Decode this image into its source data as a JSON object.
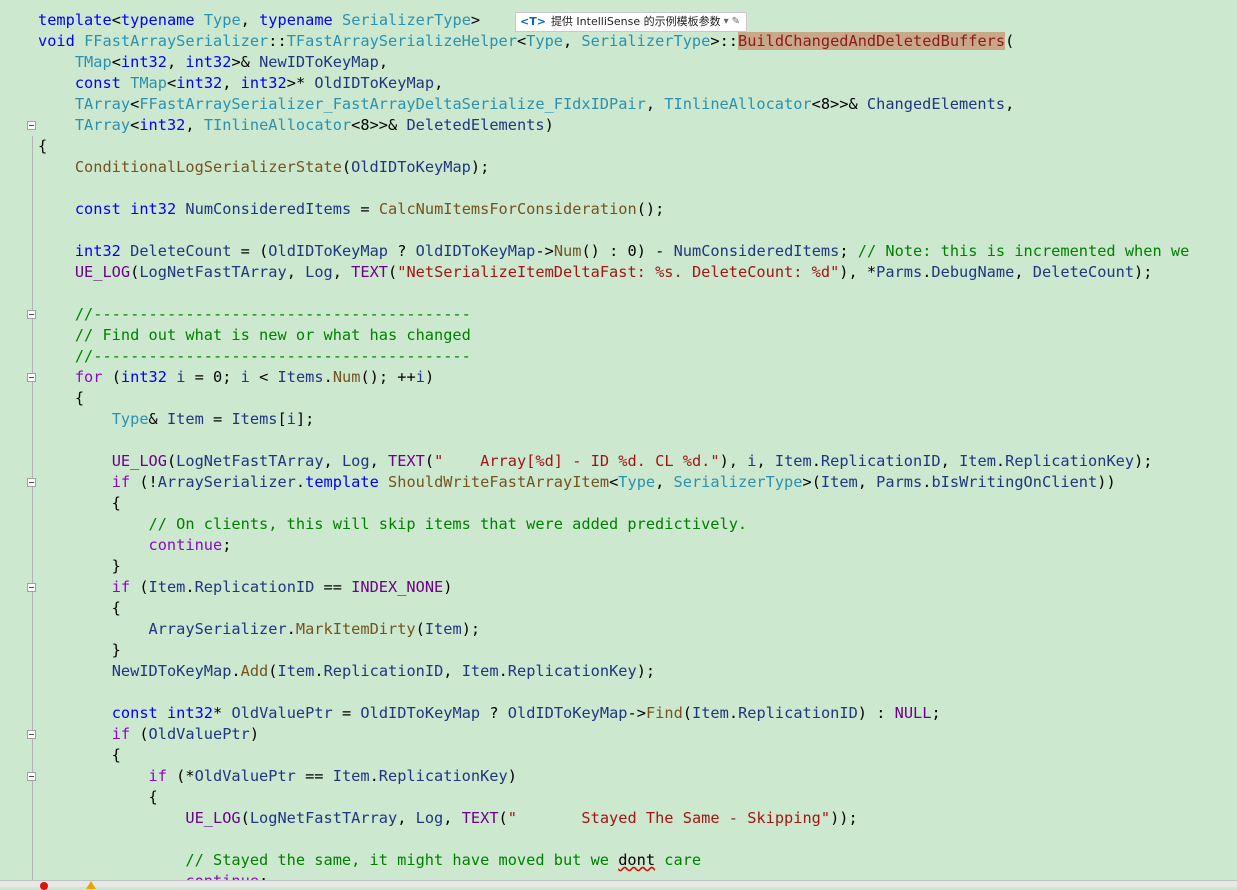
{
  "intellisense": {
    "badge": "<T>",
    "text": "提供 IntelliSense 的示例模板参数",
    "chevron": "▾",
    "edit_icon": "✎"
  },
  "colors": {
    "background": "#cce8cf",
    "keyword": "#0000ff",
    "type": "#2b91af",
    "function": "#74531f",
    "macro": "#6f008a",
    "string": "#a31515",
    "comment": "#008000",
    "highlight": "#c9a888"
  },
  "code_lines": [
    [
      [
        "kw",
        "template"
      ],
      [
        "pl",
        "<"
      ],
      [
        "kw",
        "typename"
      ],
      [
        "pl",
        " "
      ],
      [
        "ty",
        "Type"
      ],
      [
        "pl",
        ", "
      ],
      [
        "kw",
        "typename"
      ],
      [
        "pl",
        " "
      ],
      [
        "ty",
        "SerializerType"
      ],
      [
        "pl",
        ">"
      ]
    ],
    [
      [
        "kw",
        "void"
      ],
      [
        "pl",
        " "
      ],
      [
        "ty",
        "FFastArraySerializer"
      ],
      [
        "pl",
        "::"
      ],
      [
        "ty",
        "TFastArraySerializeHelper"
      ],
      [
        "pl",
        "<"
      ],
      [
        "ty",
        "Type"
      ],
      [
        "pl",
        ", "
      ],
      [
        "ty",
        "SerializerType"
      ],
      [
        "pl",
        ">::"
      ],
      [
        "hl",
        "BuildChangedAndDeletedBuffers"
      ],
      [
        "pl",
        "("
      ]
    ],
    [
      [
        "pl",
        "    "
      ],
      [
        "ty",
        "TMap"
      ],
      [
        "pl",
        "<"
      ],
      [
        "kw",
        "int32"
      ],
      [
        "pl",
        ", "
      ],
      [
        "kw",
        "int32"
      ],
      [
        "pl",
        ">& "
      ],
      [
        "var",
        "NewIDToKeyMap"
      ],
      [
        "pl",
        ","
      ]
    ],
    [
      [
        "pl",
        "    "
      ],
      [
        "kw",
        "const"
      ],
      [
        "pl",
        " "
      ],
      [
        "ty",
        "TMap"
      ],
      [
        "pl",
        "<"
      ],
      [
        "kw",
        "int32"
      ],
      [
        "pl",
        ", "
      ],
      [
        "kw",
        "int32"
      ],
      [
        "pl",
        ">* "
      ],
      [
        "var",
        "OldIDToKeyMap"
      ],
      [
        "pl",
        ","
      ]
    ],
    [
      [
        "pl",
        "    "
      ],
      [
        "ty",
        "TArray"
      ],
      [
        "pl",
        "<"
      ],
      [
        "ty",
        "FFastArraySerializer_FastArrayDeltaSerialize_FIdxIDPair"
      ],
      [
        "pl",
        ", "
      ],
      [
        "ty",
        "TInlineAllocator"
      ],
      [
        "pl",
        "<8>>& "
      ],
      [
        "var",
        "ChangedElements"
      ],
      [
        "pl",
        ","
      ]
    ],
    [
      [
        "pl",
        "    "
      ],
      [
        "ty",
        "TArray"
      ],
      [
        "pl",
        "<"
      ],
      [
        "kw",
        "int32"
      ],
      [
        "pl",
        ", "
      ],
      [
        "ty",
        "TInlineAllocator"
      ],
      [
        "pl",
        "<8>>& "
      ],
      [
        "var",
        "DeletedElements"
      ],
      [
        "pl",
        ")"
      ]
    ],
    [
      [
        "pl",
        "{"
      ]
    ],
    [
      [
        "pl",
        "    "
      ],
      [
        "fn",
        "ConditionalLogSerializerState"
      ],
      [
        "pl",
        "("
      ],
      [
        "var",
        "OldIDToKeyMap"
      ],
      [
        "pl",
        ");"
      ]
    ],
    [
      [
        "pl",
        ""
      ]
    ],
    [
      [
        "pl",
        "    "
      ],
      [
        "kw",
        "const"
      ],
      [
        "pl",
        " "
      ],
      [
        "kw",
        "int32"
      ],
      [
        "pl",
        " "
      ],
      [
        "var",
        "NumConsideredItems"
      ],
      [
        "pl",
        " = "
      ],
      [
        "fn",
        "CalcNumItemsForConsideration"
      ],
      [
        "pl",
        "();"
      ]
    ],
    [
      [
        "pl",
        ""
      ]
    ],
    [
      [
        "pl",
        "    "
      ],
      [
        "kw",
        "int32"
      ],
      [
        "pl",
        " "
      ],
      [
        "var",
        "DeleteCount"
      ],
      [
        "pl",
        " = ("
      ],
      [
        "var",
        "OldIDToKeyMap"
      ],
      [
        "pl",
        " ? "
      ],
      [
        "var",
        "OldIDToKeyMap"
      ],
      [
        "pl",
        "->"
      ],
      [
        "fn",
        "Num"
      ],
      [
        "pl",
        "() : 0) - "
      ],
      [
        "var",
        "NumConsideredItems"
      ],
      [
        "pl",
        "; "
      ],
      [
        "com",
        "// Note: this is incremented when we"
      ]
    ],
    [
      [
        "pl",
        "    "
      ],
      [
        "mac",
        "UE_LOG"
      ],
      [
        "pl",
        "("
      ],
      [
        "var",
        "LogNetFastTArray"
      ],
      [
        "pl",
        ", "
      ],
      [
        "var",
        "Log"
      ],
      [
        "pl",
        ", "
      ],
      [
        "mac",
        "TEXT"
      ],
      [
        "pl",
        "("
      ],
      [
        "str",
        "\"NetSerializeItemDeltaFast: %s. DeleteCount: %d\""
      ],
      [
        "pl",
        "), *"
      ],
      [
        "var",
        "Parms"
      ],
      [
        "pl",
        "."
      ],
      [
        "mem",
        "DebugName"
      ],
      [
        "pl",
        ", "
      ],
      [
        "var",
        "DeleteCount"
      ],
      [
        "pl",
        ");"
      ]
    ],
    [
      [
        "pl",
        ""
      ]
    ],
    [
      [
        "pl",
        "    "
      ],
      [
        "com",
        "//-----------------------------------------"
      ]
    ],
    [
      [
        "pl",
        "    "
      ],
      [
        "com",
        "// Find out what is new or what has changed"
      ]
    ],
    [
      [
        "pl",
        "    "
      ],
      [
        "com",
        "//-----------------------------------------"
      ]
    ],
    [
      [
        "pl",
        "    "
      ],
      [
        "ctl",
        "for"
      ],
      [
        "pl",
        " ("
      ],
      [
        "kw",
        "int32"
      ],
      [
        "pl",
        " "
      ],
      [
        "var",
        "i"
      ],
      [
        "pl",
        " = 0; "
      ],
      [
        "var",
        "i"
      ],
      [
        "pl",
        " < "
      ],
      [
        "mem",
        "Items"
      ],
      [
        "pl",
        "."
      ],
      [
        "fn",
        "Num"
      ],
      [
        "pl",
        "(); ++"
      ],
      [
        "var",
        "i"
      ],
      [
        "pl",
        ")"
      ]
    ],
    [
      [
        "pl",
        "    {"
      ]
    ],
    [
      [
        "pl",
        "        "
      ],
      [
        "ty",
        "Type"
      ],
      [
        "pl",
        "& "
      ],
      [
        "var",
        "Item"
      ],
      [
        "pl",
        " = "
      ],
      [
        "mem",
        "Items"
      ],
      [
        "pl",
        "["
      ],
      [
        "var",
        "i"
      ],
      [
        "pl",
        "];"
      ]
    ],
    [
      [
        "pl",
        ""
      ]
    ],
    [
      [
        "pl",
        "        "
      ],
      [
        "mac",
        "UE_LOG"
      ],
      [
        "pl",
        "("
      ],
      [
        "var",
        "LogNetFastTArray"
      ],
      [
        "pl",
        ", "
      ],
      [
        "var",
        "Log"
      ],
      [
        "pl",
        ", "
      ],
      [
        "mac",
        "TEXT"
      ],
      [
        "pl",
        "("
      ],
      [
        "str",
        "\"    Array[%d] - ID %d. CL %d.\""
      ],
      [
        "pl",
        "), "
      ],
      [
        "var",
        "i"
      ],
      [
        "pl",
        ", "
      ],
      [
        "var",
        "Item"
      ],
      [
        "pl",
        "."
      ],
      [
        "mem",
        "ReplicationID"
      ],
      [
        "pl",
        ", "
      ],
      [
        "var",
        "Item"
      ],
      [
        "pl",
        "."
      ],
      [
        "mem",
        "ReplicationKey"
      ],
      [
        "pl",
        ");"
      ]
    ],
    [
      [
        "pl",
        "        "
      ],
      [
        "ctl",
        "if"
      ],
      [
        "pl",
        " (!"
      ],
      [
        "var",
        "ArraySerializer"
      ],
      [
        "pl",
        "."
      ],
      [
        "kw",
        "template"
      ],
      [
        "pl",
        " "
      ],
      [
        "fn",
        "ShouldWriteFastArrayItem"
      ],
      [
        "pl",
        "<"
      ],
      [
        "ty",
        "Type"
      ],
      [
        "pl",
        ", "
      ],
      [
        "ty",
        "SerializerType"
      ],
      [
        "pl",
        ">("
      ],
      [
        "var",
        "Item"
      ],
      [
        "pl",
        ", "
      ],
      [
        "var",
        "Parms"
      ],
      [
        "pl",
        "."
      ],
      [
        "mem",
        "bIsWritingOnClient"
      ],
      [
        "pl",
        "))"
      ]
    ],
    [
      [
        "pl",
        "        {"
      ]
    ],
    [
      [
        "pl",
        "            "
      ],
      [
        "com",
        "// On clients, this will skip items that were added predictively."
      ]
    ],
    [
      [
        "pl",
        "            "
      ],
      [
        "ctl",
        "continue"
      ],
      [
        "pl",
        ";"
      ]
    ],
    [
      [
        "pl",
        "        }"
      ]
    ],
    [
      [
        "pl",
        "        "
      ],
      [
        "ctl",
        "if"
      ],
      [
        "pl",
        " ("
      ],
      [
        "var",
        "Item"
      ],
      [
        "pl",
        "."
      ],
      [
        "mem",
        "ReplicationID"
      ],
      [
        "pl",
        " == "
      ],
      [
        "mac",
        "INDEX_NONE"
      ],
      [
        "pl",
        ")"
      ]
    ],
    [
      [
        "pl",
        "        {"
      ]
    ],
    [
      [
        "pl",
        "            "
      ],
      [
        "var",
        "ArraySerializer"
      ],
      [
        "pl",
        "."
      ],
      [
        "fn",
        "MarkItemDirty"
      ],
      [
        "pl",
        "("
      ],
      [
        "var",
        "Item"
      ],
      [
        "pl",
        ");"
      ]
    ],
    [
      [
        "pl",
        "        }"
      ]
    ],
    [
      [
        "pl",
        "        "
      ],
      [
        "var",
        "NewIDToKeyMap"
      ],
      [
        "pl",
        "."
      ],
      [
        "fn",
        "Add"
      ],
      [
        "pl",
        "("
      ],
      [
        "var",
        "Item"
      ],
      [
        "pl",
        "."
      ],
      [
        "mem",
        "ReplicationID"
      ],
      [
        "pl",
        ", "
      ],
      [
        "var",
        "Item"
      ],
      [
        "pl",
        "."
      ],
      [
        "mem",
        "ReplicationKey"
      ],
      [
        "pl",
        ");"
      ]
    ],
    [
      [
        "pl",
        ""
      ]
    ],
    [
      [
        "pl",
        "        "
      ],
      [
        "kw",
        "const"
      ],
      [
        "pl",
        " "
      ],
      [
        "kw",
        "int32"
      ],
      [
        "pl",
        "* "
      ],
      [
        "var",
        "OldValuePtr"
      ],
      [
        "pl",
        " = "
      ],
      [
        "var",
        "OldIDToKeyMap"
      ],
      [
        "pl",
        " ? "
      ],
      [
        "var",
        "OldIDToKeyMap"
      ],
      [
        "pl",
        "->"
      ],
      [
        "fn",
        "Find"
      ],
      [
        "pl",
        "("
      ],
      [
        "var",
        "Item"
      ],
      [
        "pl",
        "."
      ],
      [
        "mem",
        "ReplicationID"
      ],
      [
        "pl",
        ") : "
      ],
      [
        "mac",
        "NULL"
      ],
      [
        "pl",
        ";"
      ]
    ],
    [
      [
        "pl",
        "        "
      ],
      [
        "ctl",
        "if"
      ],
      [
        "pl",
        " ("
      ],
      [
        "var",
        "OldValuePtr"
      ],
      [
        "pl",
        ")"
      ]
    ],
    [
      [
        "pl",
        "        {"
      ]
    ],
    [
      [
        "pl",
        "            "
      ],
      [
        "ctl",
        "if"
      ],
      [
        "pl",
        " (*"
      ],
      [
        "var",
        "OldValuePtr"
      ],
      [
        "pl",
        " == "
      ],
      [
        "var",
        "Item"
      ],
      [
        "pl",
        "."
      ],
      [
        "mem",
        "ReplicationKey"
      ],
      [
        "pl",
        ")"
      ]
    ],
    [
      [
        "pl",
        "            {"
      ]
    ],
    [
      [
        "pl",
        "                "
      ],
      [
        "mac",
        "UE_LOG"
      ],
      [
        "pl",
        "("
      ],
      [
        "var",
        "LogNetFastTArray"
      ],
      [
        "pl",
        ", "
      ],
      [
        "var",
        "Log"
      ],
      [
        "pl",
        ", "
      ],
      [
        "mac",
        "TEXT"
      ],
      [
        "pl",
        "("
      ],
      [
        "str",
        "\"       Stayed The Same - Skipping\""
      ],
      [
        "pl",
        "));"
      ]
    ],
    [
      [
        "pl",
        ""
      ]
    ],
    [
      [
        "pl",
        "                "
      ],
      [
        "com",
        "// Stayed the same, it might have moved but we "
      ],
      [
        "squig",
        "dont"
      ],
      [
        "com",
        " care"
      ]
    ],
    [
      [
        "pl",
        "                "
      ],
      [
        "ctl",
        "continue"
      ],
      [
        "pl",
        ";"
      ]
    ]
  ]
}
